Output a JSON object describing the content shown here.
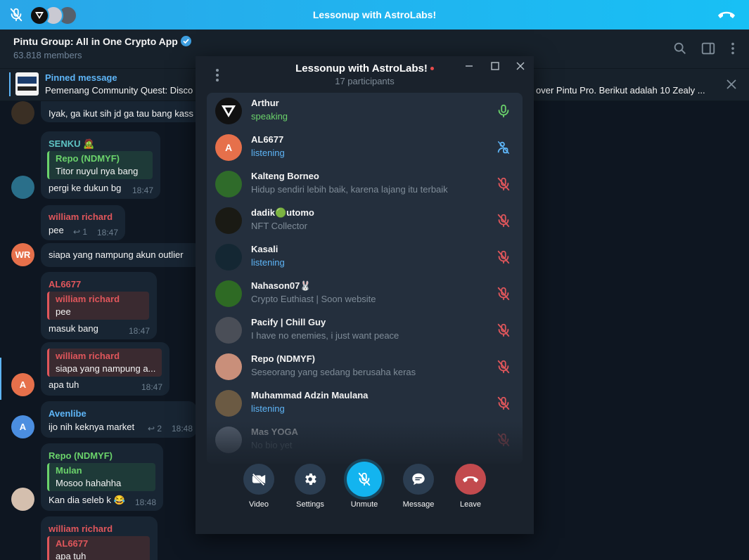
{
  "colors": {
    "accent": "#2aa6e8",
    "speaking_green": "#6bd36b",
    "listening_blue": "#5eb5f7",
    "muted_red": "#e0565b",
    "chat_bg": "#0e1621",
    "panel_bg": "#1a222c"
  },
  "callbar": {
    "title": "Lessonup with AstroLabs!",
    "mic_icon": "mic-off-icon",
    "hangup_icon": "phone-hangup-icon"
  },
  "header": {
    "title": "Pintu Group: All in One Crypto App",
    "members": "63.818 members",
    "icons": [
      "search-icon",
      "sidebar-toggle-icon",
      "more-vertical-icon"
    ]
  },
  "pinned": {
    "label": "Pinned message",
    "text_left": "Pemenang Community Quest: Disco",
    "text_right": "over Pintu Pro.  Berikut adalah 10 Zealy ..."
  },
  "messages": {
    "m0": {
      "text": "Iyak, ga ikut sih jd ga tau bang kass"
    },
    "m1": {
      "sender": "SENKU",
      "quote_sender": "Repo (NDMYF)",
      "quote_text": "Titor nuyul nya bang",
      "text": "pergi ke dukun bg",
      "time": "18:47"
    },
    "m2": {
      "sender": "william richard",
      "text": "pee",
      "replies": "1",
      "time": "18:47"
    },
    "m3": {
      "avatar": "WR",
      "text": "siapa yang nampung akun outlier"
    },
    "m4": {
      "sender": "AL6677",
      "quote_sender": "william richard",
      "quote_text": "pee",
      "text": "masuk bang",
      "time": "18:47"
    },
    "m5": {
      "avatar": "A",
      "quote_sender": "william richard",
      "quote_text": "siapa yang nampung a...",
      "text": "apa tuh",
      "time": "18:47"
    },
    "m6": {
      "avatar": "A",
      "sender": "Avenlibe",
      "text": "ijo nih keknya market",
      "replies": "2",
      "time": "18:48"
    },
    "m7": {
      "sender": "Repo (NDMYF)",
      "quote_sender": "Mulan",
      "quote_text": "Mosoo hahahha",
      "text": "Kan dia seleb k 😂",
      "time": "18:48"
    },
    "m8": {
      "sender": "william richard",
      "quote_sender": "AL6677",
      "quote_text": "apa tuh"
    }
  },
  "panel": {
    "title": "Lessonup with AstroLabs!",
    "participants_count": "17 participants",
    "participants": [
      {
        "name": "Arthur",
        "status": "speaking",
        "status_type": "speaking",
        "mic": "mic-on-icon"
      },
      {
        "name": "AL6677",
        "status": "listening",
        "status_type": "listening",
        "mic": "hand-raise-icon",
        "avatar_letter": "A"
      },
      {
        "name": "Kalteng Borneo",
        "status": "Hidup sendiri lebih baik, karena lajang itu terbaik",
        "status_type": "bio",
        "mic": "mic-off-icon"
      },
      {
        "name": "dadik🟢utomo",
        "status": "NFT Collector",
        "status_type": "bio",
        "mic": "mic-off-icon"
      },
      {
        "name": "Kasali",
        "status": "listening",
        "status_type": "listening",
        "mic": "mic-off-icon"
      },
      {
        "name": "Nahason07🐰",
        "status": "Crypto Euthiast | Soon website",
        "status_type": "bio",
        "mic": "mic-off-icon"
      },
      {
        "name": "Pacify | Chill Guy",
        "status": "I have no enemies, i just want peace",
        "status_type": "bio",
        "mic": "mic-off-icon"
      },
      {
        "name": "Repo (NDMYF)",
        "status": "Seseorang yang sedang berusaha keras",
        "status_type": "bio",
        "mic": "mic-off-icon"
      },
      {
        "name": "Muhammad Adzin Maulana",
        "status": "listening",
        "status_type": "listening",
        "mic": "mic-off-icon"
      },
      {
        "name": "Mas YOGA",
        "status": "No bio yet",
        "status_type": "bio",
        "mic": "mic-off-icon"
      }
    ],
    "controls": {
      "video": "Video",
      "settings": "Settings",
      "unmute": "Unmute",
      "message": "Message",
      "leave": "Leave"
    }
  }
}
